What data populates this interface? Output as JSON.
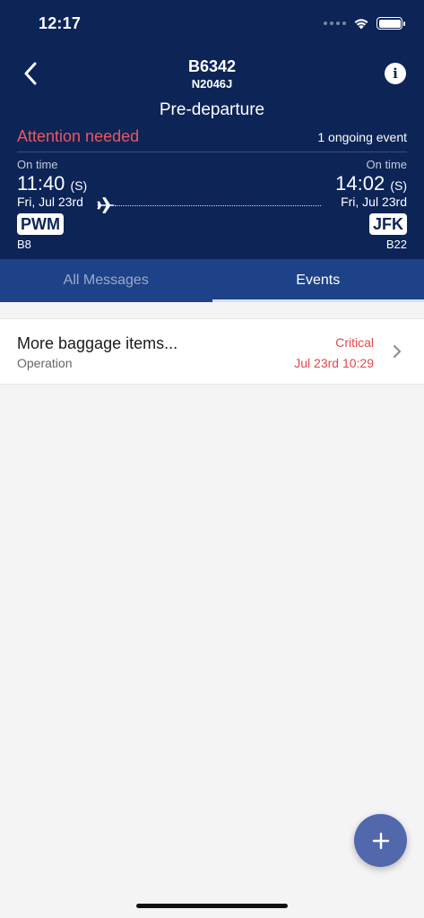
{
  "status_bar": {
    "time": "12:17"
  },
  "header": {
    "flight_number": "B6342",
    "tail_number": "N2046J",
    "phase": "Pre-departure",
    "attention": "Attention needed",
    "ongoing_events": "1 ongoing event"
  },
  "departure": {
    "status": "On time",
    "time": "11:40",
    "time_type": "(S)",
    "date": "Fri, Jul 23rd",
    "airport": "PWM",
    "gate": "B8"
  },
  "arrival": {
    "status": "On time",
    "time": "14:02",
    "time_type": "(S)",
    "date": "Fri, Jul 23rd",
    "airport": "JFK",
    "gate": "B22"
  },
  "tabs": [
    {
      "label": "All Messages",
      "active": false
    },
    {
      "label": "Events",
      "active": true
    }
  ],
  "events": [
    {
      "title": "More baggage items...",
      "type": "Operation",
      "severity": "Critical",
      "time": "Jul 23rd 10:29"
    }
  ],
  "colors": {
    "header_bg": "#0c2456",
    "tab_bar_bg": "#1e4287",
    "alert_red": "#f0555c",
    "fab_bg": "#5268ad"
  },
  "icons": {
    "back": "chevron-left-icon",
    "info": "info-icon",
    "plane": "airplane-icon",
    "row_chevron": "chevron-right-icon",
    "fab": "plus-icon"
  }
}
